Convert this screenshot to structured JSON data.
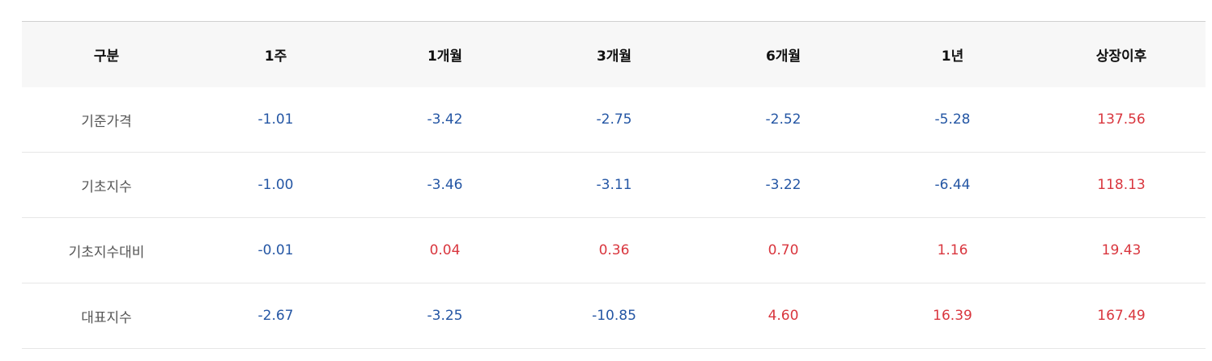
{
  "table": {
    "headers": [
      "구분",
      "1주",
      "1개월",
      "3개월",
      "6개월",
      "1년",
      "상장이후"
    ],
    "rows": [
      {
        "label": "기준가격",
        "values": [
          "-1.01",
          "-3.42",
          "-2.75",
          "-2.52",
          "-5.28",
          "137.56"
        ]
      },
      {
        "label": "기초지수",
        "values": [
          "-1.00",
          "-3.46",
          "-3.11",
          "-3.22",
          "-6.44",
          "118.13"
        ]
      },
      {
        "label": "기초지수대비",
        "values": [
          "-0.01",
          "0.04",
          "0.36",
          "0.70",
          "1.16",
          "19.43"
        ]
      },
      {
        "label": "대표지수",
        "values": [
          "-2.67",
          "-3.25",
          "-10.85",
          "4.60",
          "16.39",
          "167.49"
        ]
      }
    ]
  },
  "colors": {
    "negative": "#2456a4",
    "positive": "#d9363e",
    "header_bg": "#f7f7f7"
  }
}
